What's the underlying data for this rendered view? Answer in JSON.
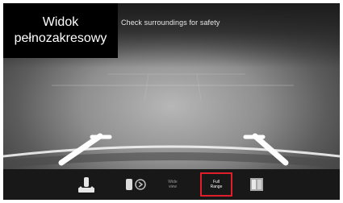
{
  "overlay_title": {
    "line1": "Widok",
    "line2": "pełnozakresowy"
  },
  "camera": {
    "warning_text": "Check surroundings for safety"
  },
  "toolbar": {
    "buttons": [
      {
        "icon": "parking-sensor-car-icon"
      },
      {
        "icon": "car-sensor-signal-icon"
      },
      {
        "line1": "Wide",
        "line2": "view"
      },
      {
        "line1": "Full",
        "line2": "Range",
        "active": true
      },
      {
        "icon": "split-view-icon"
      }
    ],
    "active_border_color": "#e01d28"
  }
}
